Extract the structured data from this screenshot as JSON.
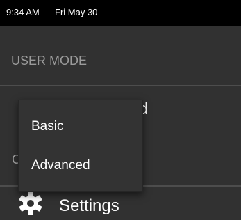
{
  "status_bar": {
    "time": "9:34 AM",
    "date": "Fri May 30"
  },
  "user_mode": {
    "header": "USER MODE",
    "selected_value_visible": "d",
    "second_row_visible": "C"
  },
  "settings": {
    "label": "Settings",
    "icon": "gear-icon"
  },
  "dropdown": {
    "options": [
      {
        "label": "Basic"
      },
      {
        "label": "Advanced"
      }
    ]
  },
  "colors": {
    "background": "#313131",
    "status_bar": "#000000",
    "header_text": "#9b9b9b",
    "divider": "#4d4d4d"
  }
}
